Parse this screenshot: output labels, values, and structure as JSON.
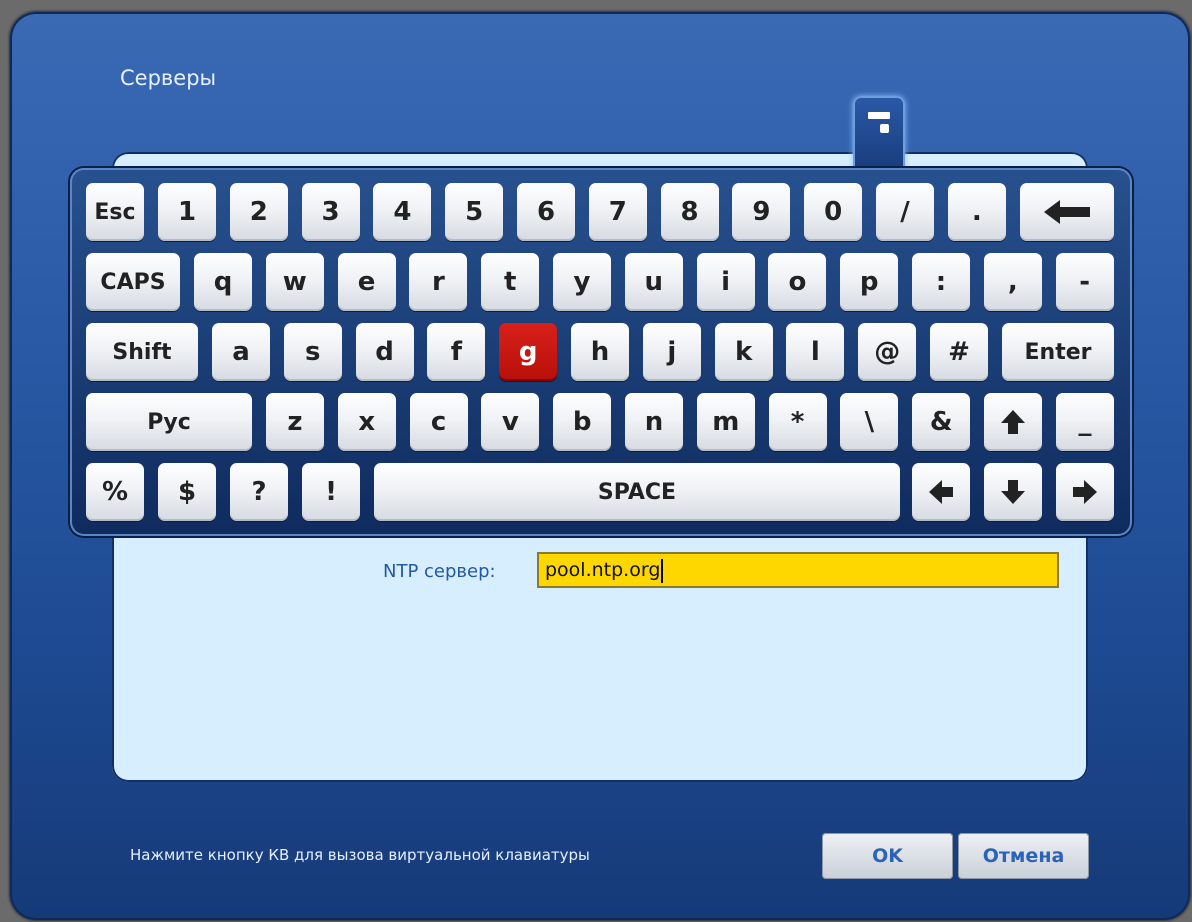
{
  "dialog": {
    "title": "Серверы",
    "hint": "Нажмите кнопку КВ для вызова виртуальной клавиатуры",
    "ok_label": "OK",
    "cancel_label": "Отмена"
  },
  "form": {
    "ntp_label": "NTP сервер:",
    "ntp_value": "pool.ntp.org"
  },
  "keyboard": {
    "active_key": "g",
    "rows": [
      [
        "Esc",
        "1",
        "2",
        "3",
        "4",
        "5",
        "6",
        "7",
        "8",
        "9",
        "0",
        "/",
        ".",
        "backspace-arrow-icon"
      ],
      [
        "CAPS",
        "q",
        "w",
        "e",
        "r",
        "t",
        "y",
        "u",
        "i",
        "o",
        "p",
        ":",
        ",",
        "-"
      ],
      [
        "Shift",
        "a",
        "s",
        "d",
        "f",
        "g",
        "h",
        "j",
        "k",
        "l",
        "@",
        "#",
        "Enter"
      ],
      [
        "Рус",
        "z",
        "x",
        "c",
        "v",
        "b",
        "n",
        "m",
        "*",
        "\\",
        "&",
        "arrow-up-icon",
        "_"
      ],
      [
        "%",
        "$",
        "?",
        "!",
        "SPACE",
        "arrow-left-icon",
        "arrow-down-icon",
        "arrow-right-icon"
      ]
    ]
  },
  "colors": {
    "dialog_bg": "#2a5aa6",
    "panel_bg": "#d7eefe",
    "input_bg": "#ffd700",
    "active_key": "#c8160f",
    "label_text": "#2357a8"
  }
}
